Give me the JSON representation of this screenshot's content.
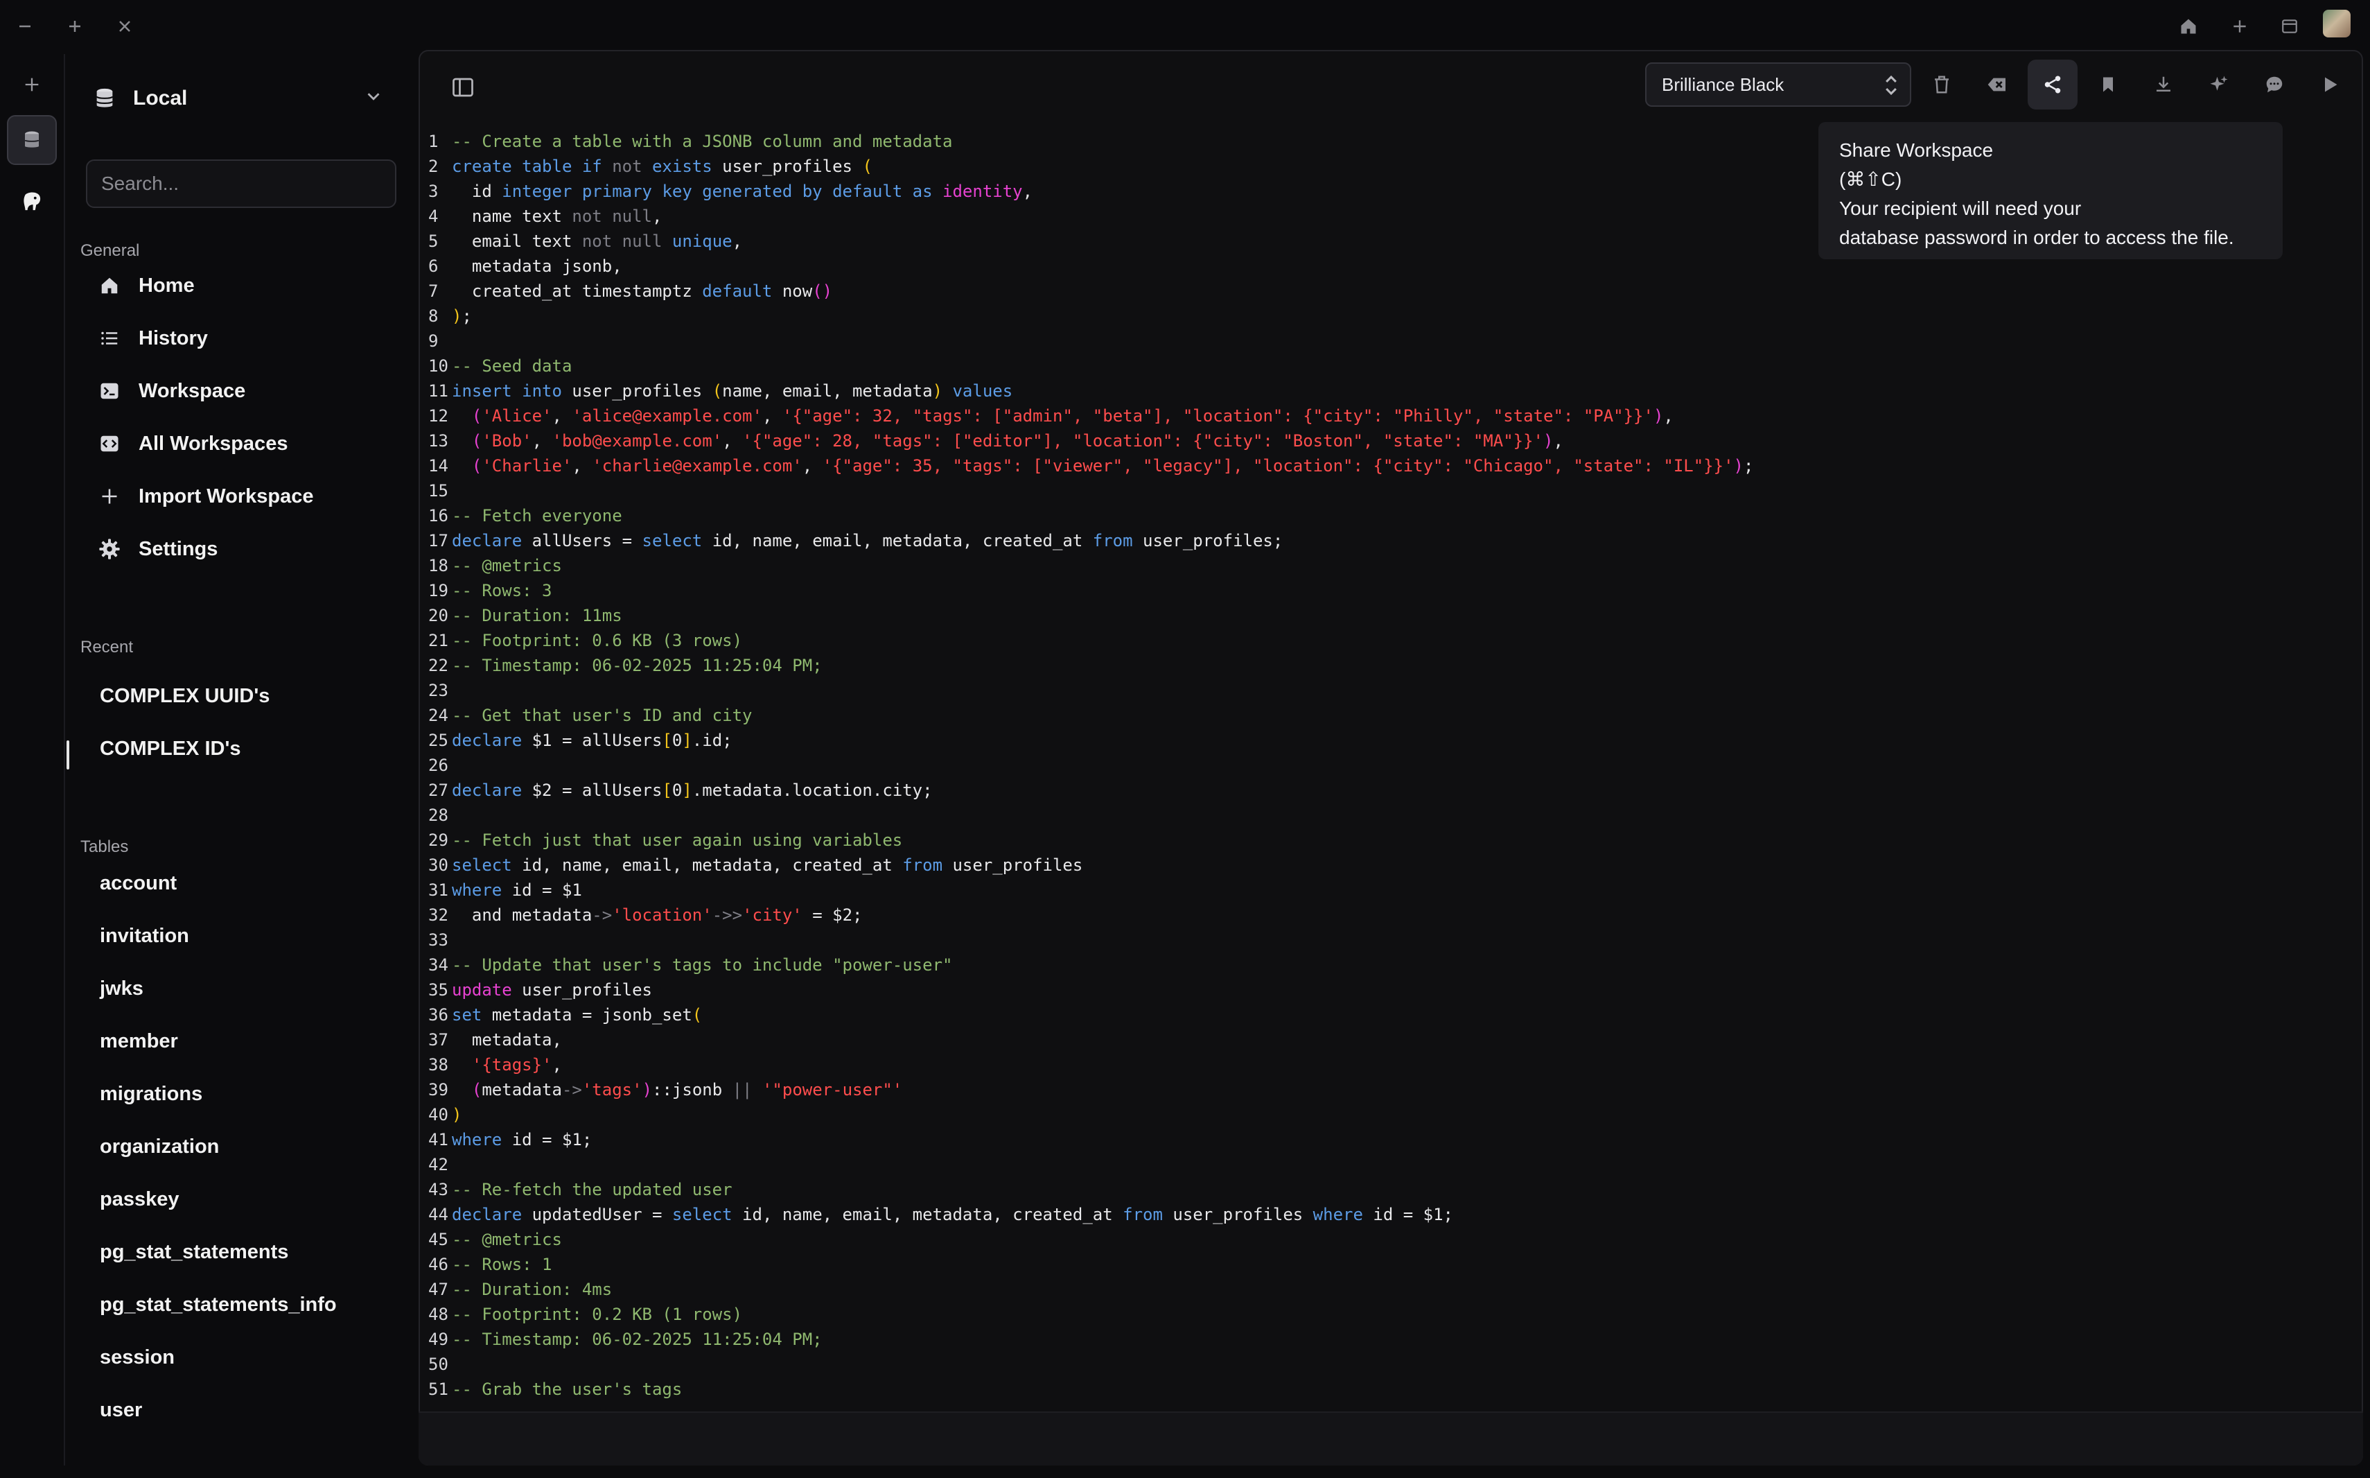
{
  "sidebar": {
    "database": "Local",
    "search_placeholder": "Search...",
    "general_title": "General",
    "general_items": [
      {
        "label": "Home",
        "icon": "home-icon"
      },
      {
        "label": "History",
        "icon": "list-icon"
      },
      {
        "label": "Workspace",
        "icon": "terminal-icon"
      },
      {
        "label": "All Workspaces",
        "icon": "code-box-icon"
      },
      {
        "label": "Import Workspace",
        "icon": "plus-icon"
      },
      {
        "label": "Settings",
        "icon": "gear-icon"
      }
    ],
    "recent_title": "Recent",
    "recent_items": [
      "COMPLEX UUID's",
      "COMPLEX ID's"
    ],
    "tables_title": "Tables",
    "tables": [
      "account",
      "invitation",
      "jwks",
      "member",
      "migrations",
      "organization",
      "passkey",
      "pg_stat_statements",
      "pg_stat_statements_info",
      "session",
      "user"
    ]
  },
  "toolbar": {
    "theme": "Brilliance Black"
  },
  "tooltip": {
    "title": "Share Workspace",
    "shortcut": "(⌘⇧C)",
    "line1": "Your recipient will need your",
    "line2": "database password in order to access the file."
  },
  "colors": {
    "comment": "#8fb86f",
    "keyword": "#5c9ce6",
    "string": "#ff4d4d",
    "function_accent": "#e642d0",
    "bracket": "#f2c41c"
  },
  "editor": {
    "lines": [
      [
        [
          "c",
          "-- Create a table with a JSONB column and metadata"
        ]
      ],
      [
        [
          "k",
          "create table if "
        ],
        [
          "n",
          "not "
        ],
        [
          "k",
          "exists "
        ],
        [
          "d",
          "user_profiles "
        ],
        [
          "b",
          "("
        ]
      ],
      [
        [
          "d",
          "  id "
        ],
        [
          "k",
          "integer primary key generated by default as "
        ],
        [
          "m",
          "identity"
        ],
        [
          "d",
          ","
        ]
      ],
      [
        [
          "d",
          "  name text "
        ],
        [
          "n",
          "not null"
        ],
        [
          "d",
          ","
        ]
      ],
      [
        [
          "d",
          "  email text "
        ],
        [
          "n",
          "not null "
        ],
        [
          "k",
          "unique"
        ],
        [
          "d",
          ","
        ]
      ],
      [
        [
          "d",
          "  metadata jsonb,"
        ]
      ],
      [
        [
          "d",
          "  created_at timestamptz "
        ],
        [
          "k",
          "default "
        ],
        [
          "d",
          "now"
        ],
        [
          "m",
          "()"
        ]
      ],
      [
        [
          "b",
          ")"
        ],
        [
          "d",
          ";"
        ]
      ],
      [],
      [
        [
          "c",
          "-- Seed data"
        ]
      ],
      [
        [
          "k",
          "insert into "
        ],
        [
          "d",
          "user_profiles "
        ],
        [
          "b",
          "("
        ],
        [
          "d",
          "name, email, metadata"
        ],
        [
          "b",
          ") "
        ],
        [
          "k",
          "values"
        ]
      ],
      [
        [
          "d",
          "  "
        ],
        [
          "m",
          "("
        ],
        [
          "s",
          "'Alice'"
        ],
        [
          "d",
          ", "
        ],
        [
          "s",
          "'alice@example.com'"
        ],
        [
          "d",
          ", "
        ],
        [
          "s",
          "'{\"age\": 32, \"tags\": [\"admin\", \"beta\"], \"location\": {\"city\": \"Philly\", \"state\": \"PA\"}}'"
        ],
        [
          "m",
          ")"
        ],
        [
          "d",
          ","
        ]
      ],
      [
        [
          "d",
          "  "
        ],
        [
          "m",
          "("
        ],
        [
          "s",
          "'Bob'"
        ],
        [
          "d",
          ", "
        ],
        [
          "s",
          "'bob@example.com'"
        ],
        [
          "d",
          ", "
        ],
        [
          "s",
          "'{\"age\": 28, \"tags\": [\"editor\"], \"location\": {\"city\": \"Boston\", \"state\": \"MA\"}}'"
        ],
        [
          "m",
          ")"
        ],
        [
          "d",
          ","
        ]
      ],
      [
        [
          "d",
          "  "
        ],
        [
          "m",
          "("
        ],
        [
          "s",
          "'Charlie'"
        ],
        [
          "d",
          ", "
        ],
        [
          "s",
          "'charlie@example.com'"
        ],
        [
          "d",
          ", "
        ],
        [
          "s",
          "'{\"age\": 35, \"tags\": [\"viewer\", \"legacy\"], \"location\": {\"city\": \"Chicago\", \"state\": \"IL\"}}'"
        ],
        [
          "m",
          ")"
        ],
        [
          "d",
          ";"
        ]
      ],
      [],
      [
        [
          "c",
          "-- Fetch everyone"
        ]
      ],
      [
        [
          "k",
          "declare "
        ],
        [
          "d",
          "allUsers = "
        ],
        [
          "k",
          "select "
        ],
        [
          "d",
          "id, name, email, metadata, created_at "
        ],
        [
          "k",
          "from "
        ],
        [
          "d",
          "user_profiles;"
        ]
      ],
      [
        [
          "c",
          "-- @metrics"
        ]
      ],
      [
        [
          "c",
          "-- Rows: 3"
        ]
      ],
      [
        [
          "c",
          "-- Duration: 11ms"
        ]
      ],
      [
        [
          "c",
          "-- Footprint: 0.6 KB (3 rows)"
        ]
      ],
      [
        [
          "c",
          "-- Timestamp: 06-02-2025 11:25:04 PM;"
        ]
      ],
      [],
      [
        [
          "c",
          "-- Get that user's ID and city"
        ]
      ],
      [
        [
          "k",
          "declare "
        ],
        [
          "d",
          "$1 = allUsers"
        ],
        [
          "b",
          "["
        ],
        [
          "d",
          "0"
        ],
        [
          "b",
          "]"
        ],
        [
          "d",
          ".id;"
        ]
      ],
      [],
      [
        [
          "k",
          "declare "
        ],
        [
          "d",
          "$2 = allUsers"
        ],
        [
          "b",
          "["
        ],
        [
          "d",
          "0"
        ],
        [
          "b",
          "]"
        ],
        [
          "d",
          ".metadata.location.city;"
        ]
      ],
      [],
      [
        [
          "c",
          "-- Fetch just that user again using variables"
        ]
      ],
      [
        [
          "k",
          "select "
        ],
        [
          "d",
          "id, name, email, metadata, created_at "
        ],
        [
          "k",
          "from "
        ],
        [
          "d",
          "user_profiles"
        ]
      ],
      [
        [
          "k",
          "where "
        ],
        [
          "d",
          "id = $1"
        ]
      ],
      [
        [
          "d",
          "  and metadata"
        ],
        [
          "n",
          "->"
        ],
        [
          "s",
          "'location'"
        ],
        [
          "n",
          "->>"
        ],
        [
          "s",
          "'city'"
        ],
        [
          "d",
          " = $2;"
        ]
      ],
      [],
      [
        [
          "c",
          "-- Update that user's tags to include \"power-user\""
        ]
      ],
      [
        [
          "m",
          "update "
        ],
        [
          "d",
          "user_profiles"
        ]
      ],
      [
        [
          "k",
          "set "
        ],
        [
          "d",
          "metadata = jsonb_set"
        ],
        [
          "b",
          "("
        ]
      ],
      [
        [
          "d",
          "  metadata,"
        ]
      ],
      [
        [
          "d",
          "  "
        ],
        [
          "s",
          "'{tags}'"
        ],
        [
          "d",
          ","
        ]
      ],
      [
        [
          "d",
          "  "
        ],
        [
          "m",
          "("
        ],
        [
          "d",
          "metadata"
        ],
        [
          "n",
          "->"
        ],
        [
          "s",
          "'tags'"
        ],
        [
          "m",
          ")"
        ],
        [
          "d",
          "::jsonb "
        ],
        [
          "n",
          "|| "
        ],
        [
          "s",
          "'\"power-user\"'"
        ]
      ],
      [
        [
          "b",
          ")"
        ]
      ],
      [
        [
          "k",
          "where "
        ],
        [
          "d",
          "id = $1;"
        ]
      ],
      [],
      [
        [
          "c",
          "-- Re-fetch the updated user"
        ]
      ],
      [
        [
          "k",
          "declare "
        ],
        [
          "d",
          "updatedUser = "
        ],
        [
          "k",
          "select "
        ],
        [
          "d",
          "id, name, email, metadata, created_at "
        ],
        [
          "k",
          "from "
        ],
        [
          "d",
          "user_profiles "
        ],
        [
          "k",
          "where "
        ],
        [
          "d",
          "id = $1;"
        ]
      ],
      [
        [
          "c",
          "-- @metrics"
        ]
      ],
      [
        [
          "c",
          "-- Rows: 1"
        ]
      ],
      [
        [
          "c",
          "-- Duration: 4ms"
        ]
      ],
      [
        [
          "c",
          "-- Footprint: 0.2 KB (1 rows)"
        ]
      ],
      [
        [
          "c",
          "-- Timestamp: 06-02-2025 11:25:04 PM;"
        ]
      ],
      [],
      [
        [
          "c",
          "-- Grab the user's tags"
        ]
      ]
    ]
  }
}
